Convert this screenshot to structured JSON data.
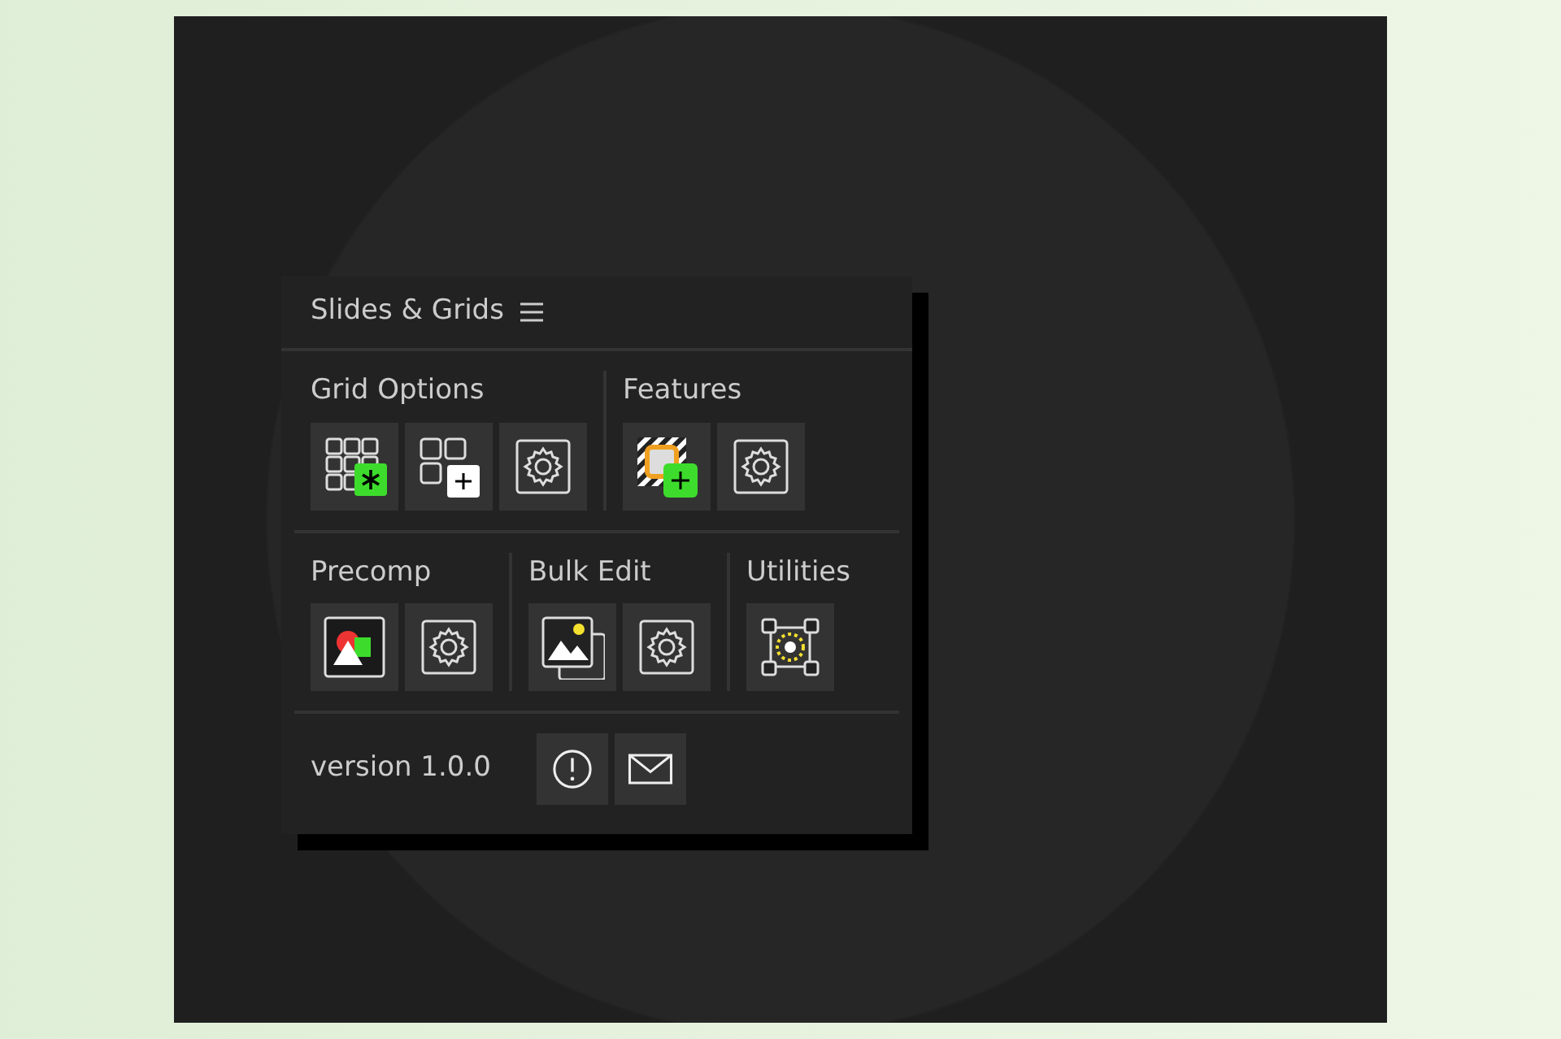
{
  "panel": {
    "title": "Slides & Grids",
    "rows": [
      [
        {
          "label": "Grid Options",
          "buttons": [
            {
              "kind": "grid-star"
            },
            {
              "kind": "grid-plus"
            },
            {
              "kind": "settings"
            }
          ]
        },
        {
          "label": "Features",
          "buttons": [
            {
              "kind": "stripe-plus"
            },
            {
              "kind": "settings"
            }
          ]
        }
      ],
      [
        {
          "label": "Precomp",
          "buttons": [
            {
              "kind": "shapes"
            },
            {
              "kind": "settings"
            }
          ]
        },
        {
          "label": "Bulk Edit",
          "buttons": [
            {
              "kind": "images"
            },
            {
              "kind": "settings"
            }
          ]
        },
        {
          "label": "Utilities",
          "buttons": [
            {
              "kind": "anchor"
            }
          ]
        }
      ]
    ],
    "footer": {
      "version": "version 1.0.0",
      "buttons": [
        {
          "kind": "info"
        },
        {
          "kind": "mail"
        }
      ]
    }
  }
}
